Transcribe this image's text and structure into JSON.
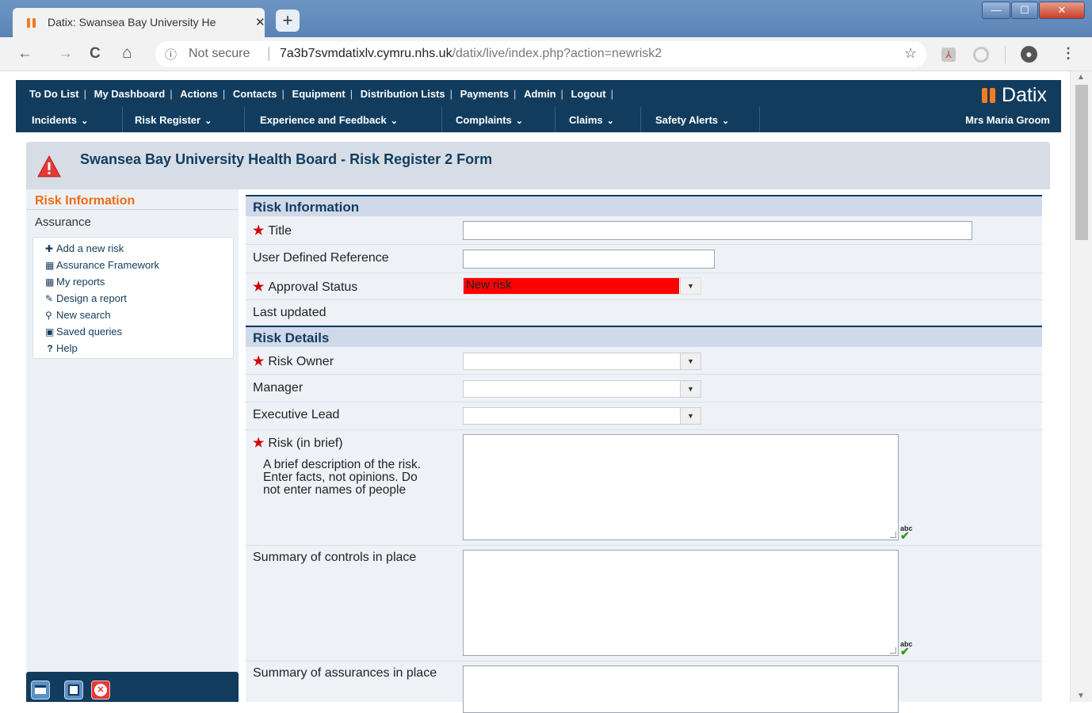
{
  "browser": {
    "tab_title": "Datix: Swansea Bay University He",
    "tab_close": "✕",
    "new_tab": "+",
    "window_controls": [
      "—",
      "☐",
      "✕"
    ],
    "nav": {
      "back": "←",
      "forward": "→",
      "reload": "C",
      "home": "⌂"
    },
    "security": "Not secure",
    "url_host": "7a3b7svmdatixlv.cymru.nhs.uk",
    "url_path": "/datix/live/index.php?action=newrisk2"
  },
  "app": {
    "top_menu": [
      "To Do List",
      "My Dashboard",
      "Actions",
      "Contacts",
      "Equipment",
      "Distribution Lists",
      "Payments",
      "Admin",
      "Logout"
    ],
    "module_menu": [
      "Incidents",
      "Risk Register",
      "Experience and Feedback",
      "Complaints",
      "Claims",
      "Safety Alerts"
    ],
    "logo_text": "Datix",
    "user": "Mrs Maria Groom",
    "form_title": "Swansea Bay University Health Board - Risk Register 2 Form"
  },
  "sidebar": {
    "active": "Risk Information",
    "second": "Assurance",
    "items": [
      {
        "icon": "plus-icon",
        "label": "Add a new risk"
      },
      {
        "icon": "framework-icon",
        "label": "Assurance Framework"
      },
      {
        "icon": "reports-icon",
        "label": "My reports"
      },
      {
        "icon": "pencil-icon",
        "label": "Design a report"
      },
      {
        "icon": "search-icon",
        "label": "New search"
      },
      {
        "icon": "floppy-icon",
        "label": "Saved queries"
      },
      {
        "icon": "help-icon",
        "label": "Help"
      }
    ]
  },
  "form": {
    "section_risk_info": "Risk Information",
    "title_label": "Title",
    "udr_label": "User Defined Reference",
    "approval_label": "Approval Status",
    "approval_value": "New risk",
    "approval_color": "#ff0000",
    "last_updated_label": "Last updated",
    "section_risk_details": "Risk Details",
    "risk_owner_label": "Risk Owner",
    "manager_label": "Manager",
    "exec_lead_label": "Executive Lead",
    "risk_brief_label": "Risk (in brief)",
    "risk_brief_hint": "A brief description of the risk. Enter facts, not opinions. Do not enter names of people",
    "controls_label": "Summary of controls in place",
    "assurances_label": "Summary of assurances in place",
    "spellcheck": "abc"
  },
  "colors": {
    "brand_navy": "#123c5e",
    "accent_orange": "#f47c20",
    "required_red": "#d40000"
  }
}
